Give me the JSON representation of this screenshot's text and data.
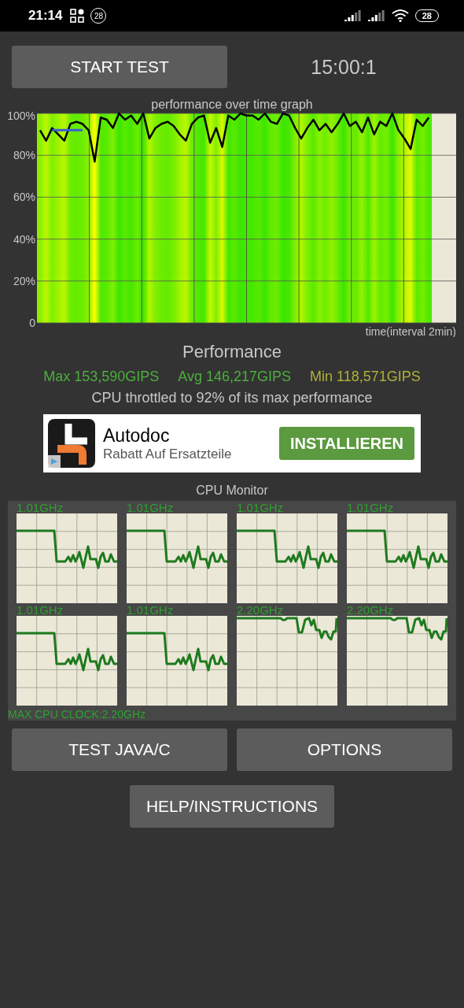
{
  "status_bar": {
    "time": "21:14",
    "notification_count": "28",
    "battery": "28"
  },
  "start_button": "START TEST",
  "timer": "15:00:1",
  "graph": {
    "chart_data": {
      "type": "line",
      "title": "performance over time graph",
      "xlabel": "time(interval 2min)",
      "ylim": [
        0,
        100
      ],
      "grid": true,
      "yticks": [
        {
          "value": 0,
          "label": "0"
        },
        {
          "value": 20,
          "label": "20%"
        },
        {
          "value": 40,
          "label": "40%"
        },
        {
          "value": 60,
          "label": "60%"
        },
        {
          "value": 80,
          "label": "80%"
        },
        {
          "value": 100,
          "label": "100%"
        }
      ],
      "series": [
        {
          "color": "#000000",
          "values": [
            92,
            87,
            93,
            90,
            87,
            95,
            96,
            95,
            92,
            77,
            98,
            97,
            93,
            100,
            97,
            99,
            95,
            100,
            88,
            93,
            95,
            96,
            94,
            90,
            87,
            95,
            98,
            99,
            86,
            93,
            84,
            99,
            97,
            100,
            99,
            99,
            97,
            100,
            96,
            95,
            100,
            99,
            93,
            88,
            93,
            97,
            92,
            95,
            91,
            95,
            100,
            94,
            96,
            91,
            98,
            90,
            96,
            94,
            100,
            92,
            88,
            83,
            97,
            94,
            98
          ]
        },
        {
          "color": "#3b5bdb",
          "values": [
            null,
            null,
            92,
            92,
            92,
            92,
            92,
            92,
            null,
            null,
            null,
            null,
            null,
            null,
            null,
            null,
            null,
            null,
            null,
            null,
            null,
            null,
            null,
            null,
            null,
            null,
            null,
            null,
            null,
            null,
            null,
            null,
            null,
            null,
            null,
            null,
            null,
            null,
            null,
            null,
            null,
            null,
            null,
            null,
            null,
            null,
            null,
            null,
            null,
            null,
            null,
            null,
            null,
            null,
            null,
            null,
            null,
            null,
            null,
            null,
            null,
            null,
            null,
            null,
            null
          ]
        }
      ]
    }
  },
  "performance": {
    "title": "Performance",
    "max": "Max 153,590GIPS",
    "avg": "Avg 146,217GIPS",
    "min": "Min 118,571GIPS",
    "throttle": "CPU throttled to 92% of its max performance"
  },
  "ad": {
    "title": "Autodoc",
    "subtitle": "Rabatt Auf Ersatzteile",
    "button": "INSTALLIEREN"
  },
  "cpu_monitor": {
    "title": "CPU Monitor",
    "cores": [
      {
        "frequency": "1.01GHz",
        "kind": "throttled"
      },
      {
        "frequency": "1.01GHz",
        "kind": "throttled"
      },
      {
        "frequency": "1.01GHz",
        "kind": "throttled"
      },
      {
        "frequency": "1.01GHz",
        "kind": "throttled"
      },
      {
        "frequency": "1.01GHz",
        "kind": "throttled"
      },
      {
        "frequency": "1.01GHz",
        "kind": "throttled"
      },
      {
        "frequency": "2.20GHz",
        "kind": "full"
      },
      {
        "frequency": "2.20GHz",
        "kind": "full"
      }
    ],
    "max_clock": "MAX CPU CLOCK:2.20GHz"
  },
  "buttons": [
    "TEST JAVA/C",
    "OPTIONS"
  ],
  "help_button": "HELP/INSTRUCTIONS"
}
